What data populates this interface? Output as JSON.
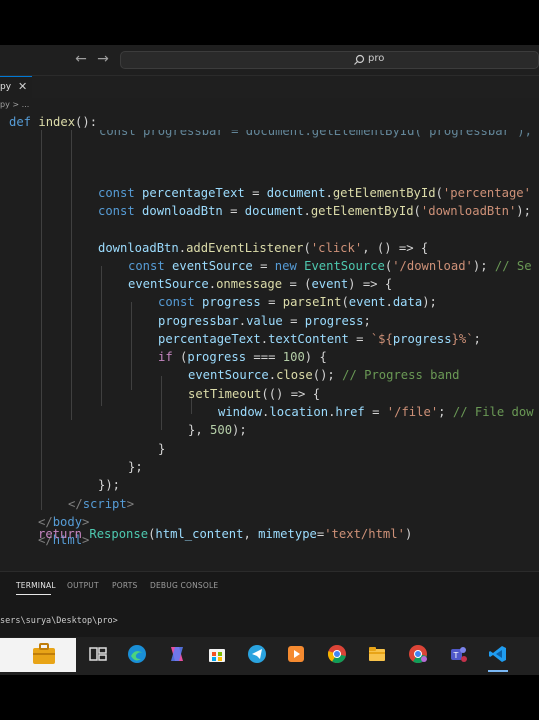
{
  "titlebar": {
    "back_label": "←",
    "forward_label": "→",
    "search_text": "pro"
  },
  "tab": {
    "label": "py",
    "close_label": "✕"
  },
  "breadcrumb": "py > ...",
  "sticky": {
    "kw": "def",
    "fn": "index",
    "rest": "():"
  },
  "code": {
    "cut_line": "const progressbar = document.getElementById('progressbar');",
    "l1_decl": "const",
    "l1_var": "percentageText",
    "l1_eq": " = ",
    "l1_obj": "document",
    "l1_fn": "getElementById",
    "l1_str": "'percentage'",
    "l2_decl": "const",
    "l2_var": "downloadBtn",
    "l2_eq": " = ",
    "l2_obj": "document",
    "l2_fn": "getElementById",
    "l2_str": "'downloadBtn'",
    "l2_end": ");",
    "l3_obj": "downloadBtn",
    "l3_fn": "addEventListener",
    "l3_str": "'click'",
    "l3_rest": ", () => {",
    "l4_decl": "const",
    "l4_var": "eventSource",
    "l4_eq": " = ",
    "l4_new": "new",
    "l4_cls": "EventSource",
    "l4_str": "'/download'",
    "l4_cm": "// Se",
    "l5_obj": "eventSource",
    "l5_prop": "onmessage",
    "l5_eq": " = (",
    "l5_param": "event",
    "l5_rest": ") => {",
    "l6_decl": "const",
    "l6_var": "progress",
    "l6_eq": " = ",
    "l6_fn": "parseInt",
    "l6_arg": "event",
    "l6_prop": "data",
    "l6_end": ");",
    "l7_obj": "progressbar",
    "l7_prop": "value",
    "l7_eq": " = ",
    "l7_val": "progress",
    "l7_end": ";",
    "l8_obj": "percentageText",
    "l8_prop": "textContent",
    "l8_eq": " = ",
    "l8_t1": "`${",
    "l8_tv": "progress",
    "l8_t2": "}%`",
    "l8_end": ";",
    "l9_kw": "if",
    "l9_open": " (",
    "l9_var": "progress",
    "l9_op": " === ",
    "l9_num": "100",
    "l9_end": ") {",
    "l10_obj": "eventSource",
    "l10_fn": "close",
    "l10_mid": "(); ",
    "l10_cm": "// Progress band",
    "l11_fn": "setTimeout",
    "l11_rest": "(() => {",
    "l12_obj1": "window",
    "l12_obj2": "location",
    "l12_prop": "href",
    "l12_eq": " = ",
    "l12_str": "'/file'",
    "l12_mid": "; ",
    "l12_cm": "// File dow",
    "l13_a": "}, ",
    "l13_num": "500",
    "l13_b": ");",
    "l14": "}",
    "l15": "};",
    "l16": "});",
    "l17_open": "</",
    "l17_tag": "script",
    "l17_close": ">",
    "l18_open": "</",
    "l18_tag": "body",
    "l18_close": ">",
    "l19_open": "</",
    "l19_tag": "html",
    "l19_close": ">",
    "l20": "\"\"\"",
    "l21_kw": "return",
    "l21_cls": "Response",
    "l21_arg": "html_content",
    "l21_comma": ", ",
    "l21_kwarg": "mimetype",
    "l21_eq": "=",
    "l21_str": "'text/html'",
    "l21_end": ")"
  },
  "panel": {
    "tabs": [
      "TERMINAL",
      "OUTPUT",
      "PORTS",
      "DEBUG CONSOLE"
    ],
    "terminal_text": "sers\\surya\\Desktop\\pro>"
  },
  "taskbar": {
    "icons": [
      "explorer-work-icon",
      "task-view-icon",
      "edge-icon",
      "copilot-icon",
      "store-icon",
      "telegram-icon",
      "media-player-icon",
      "chrome-icon",
      "file-explorer-icon",
      "chrome-profile-icon",
      "teams-icon",
      "vscode-icon"
    ]
  }
}
